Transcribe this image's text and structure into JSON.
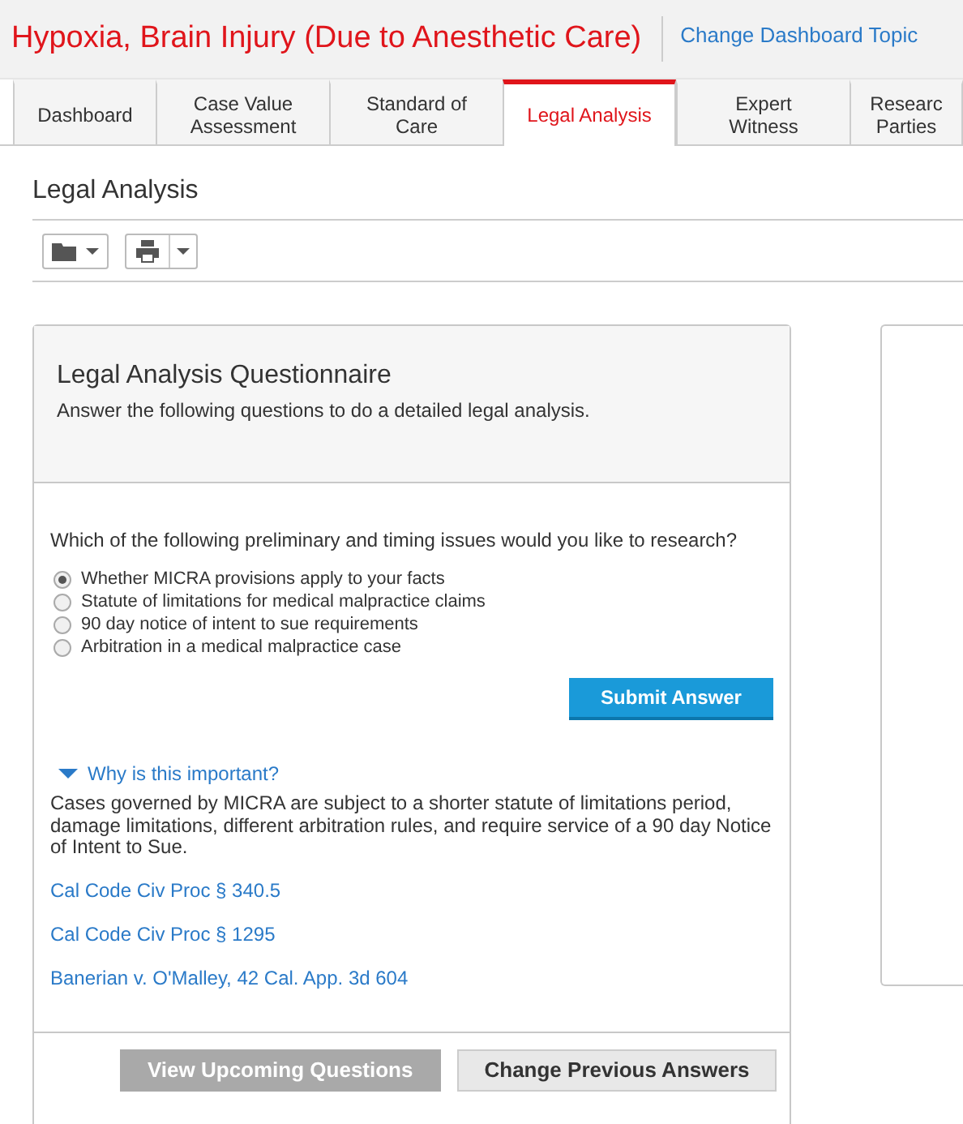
{
  "header": {
    "title": "Hypoxia, Brain Injury (Due to Anesthetic Care)",
    "link": "Change Dashboard Topic"
  },
  "tabs": [
    {
      "lines": [
        "Dashboard"
      ],
      "selected": false
    },
    {
      "lines": [
        "Case Value",
        "Assessment"
      ],
      "selected": false
    },
    {
      "lines": [
        "Standard of",
        "Care"
      ],
      "selected": false
    },
    {
      "lines": [
        "Legal Analysis"
      ],
      "selected": true
    },
    {
      "lines": [
        "Expert",
        "Witness"
      ],
      "selected": false
    },
    {
      "lines": [
        "Researc",
        "Parties"
      ],
      "selected": false
    }
  ],
  "page_title": "Legal Analysis",
  "questionnaire": {
    "title": "Legal Analysis Questionnaire",
    "subtitle": "Answer the following questions to do a detailed legal analysis.",
    "question": "Which of the following preliminary and timing issues would you like to research?",
    "options": [
      {
        "label": "Whether MICRA provisions apply to your facts",
        "selected": true
      },
      {
        "label": "Statute of limitations for medical malpractice claims",
        "selected": false
      },
      {
        "label": "90 day notice of intent to sue requirements",
        "selected": false
      },
      {
        "label": "Arbitration in a medical malpractice case",
        "selected": false
      }
    ],
    "submit": "Submit Answer",
    "explain": {
      "toggle": "Why is this important?",
      "expanded": true,
      "text": "Cases governed by MICRA are subject to a shorter statute of limitations period, damage limitations, different arbitration rules, and require service of a 90 day Notice of Intent to Sue.",
      "links": [
        "Cal Code Civ Proc § 340.5",
        "Cal Code Civ Proc § 1295",
        "Banerian v. O'Malley, 42 Cal. App. 3d 604"
      ]
    },
    "footer_buttons": [
      {
        "label": "View Upcoming Questions",
        "disabled": true
      },
      {
        "label": "Change Previous Answers",
        "disabled": false
      }
    ]
  }
}
